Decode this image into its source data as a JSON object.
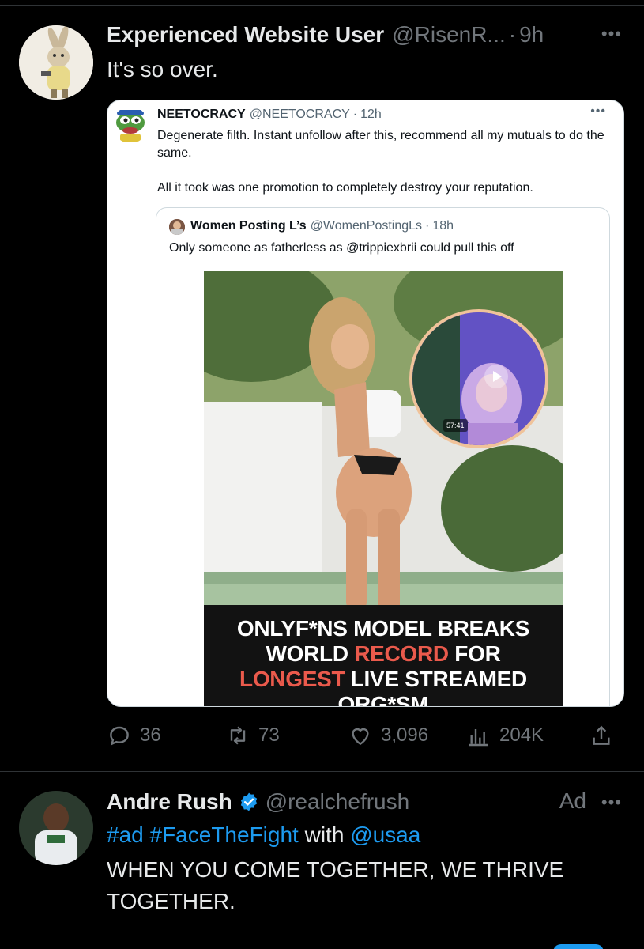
{
  "post1": {
    "author_name": "Experienced Website User",
    "author_handle": "@RisenR...",
    "separator": "·",
    "time": "9h",
    "text": "It's so over.",
    "more_label": "•••",
    "quote": {
      "author_name": "NEETOCRACY",
      "author_handle": "@NEETOCRACY",
      "separator": "·",
      "time": "12h",
      "more_label": "•••",
      "text_para1": "Degenerate filth. Instant unfollow after this, recommend all my mutuals to do the same.",
      "text_para2": "All it took was one promotion to completely destroy your reputation.",
      "nested": {
        "author_name": "Women Posting L’s",
        "author_handle": "@WomenPostingLs",
        "separator": "·",
        "time": "18h",
        "text": "Only someone as fatherless as @trippiexbrii could pull this off",
        "video_duration": "57:41",
        "headline": {
          "l1_white": "ONLYF*NS MODEL",
          "l1_red": "BREAKS",
          "l2_red_first": "WORLD",
          "l2_red": "RECORD",
          "l2_white": "FOR",
          "l3_red": "LONGEST",
          "l3_white": "LIVE STREAMED",
          "l4_white": "ORG*SM"
        }
      }
    },
    "actions": {
      "replies": "36",
      "reposts": "73",
      "likes": "3,096",
      "views": "204K"
    }
  },
  "post2": {
    "author_name": "Andre Rush",
    "author_handle": "@realchefrush",
    "ad_label": "Ad",
    "more_label": "•••",
    "hashtag1": "#ad",
    "hashtag2": "#FaceTheFight",
    "with_word": "with",
    "mention": "@usaa",
    "text": "WHEN YOU COME TOGETHER, WE THRIVE TOGETHER."
  },
  "colors": {
    "background": "#000000",
    "accent_blue": "#1d9bf0",
    "muted_gray": "#71767b",
    "headline_red": "#ea5a4c"
  }
}
